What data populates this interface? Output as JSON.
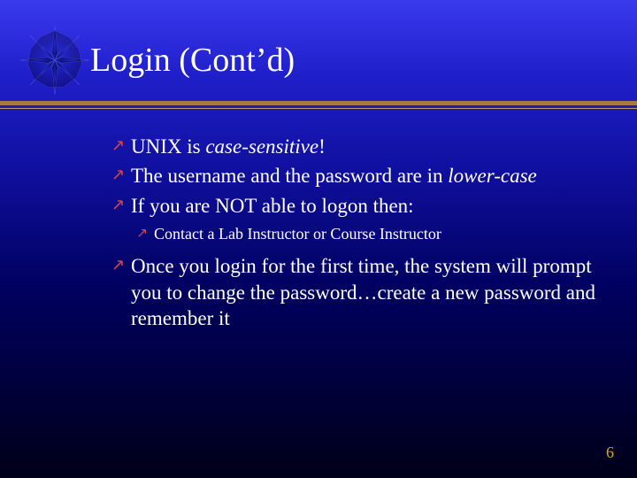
{
  "slide": {
    "title": "Login (Cont’d)",
    "bullets": {
      "b1": {
        "pre": "UNIX is ",
        "em": "case-sensitive",
        "post": "!"
      },
      "b2": {
        "pre": "The username and the password are in ",
        "em": "lower-case",
        "post": ""
      },
      "b3": {
        "text": "If you are NOT able to logon then:"
      },
      "b3sub": {
        "text": "Contact a Lab Instructor or Course Instructor"
      },
      "b4": {
        "text": "Once you login for the first time, the system will prompt you to change the password…create a new password and remember it"
      }
    },
    "page_number": "6"
  },
  "icons": {
    "star": "starburst-icon",
    "arrow": "arrow-up-right-icon"
  }
}
